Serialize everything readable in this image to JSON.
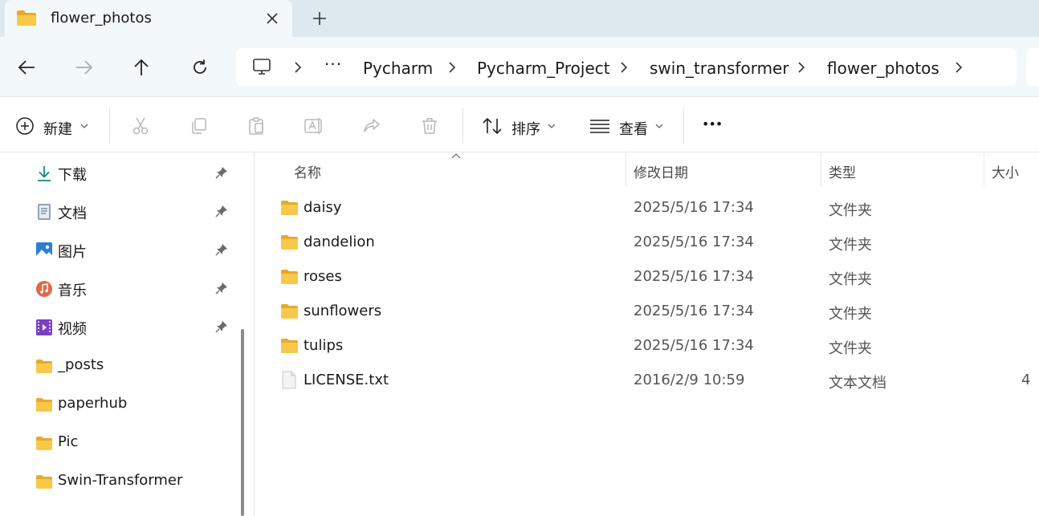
{
  "tab": {
    "title": "flower_photos",
    "close_icon": "close-icon",
    "new_tab_icon": "plus-icon"
  },
  "nav": {
    "back_icon": "arrow-left-icon",
    "forward_icon": "arrow-right-icon",
    "up_icon": "arrow-up-icon",
    "refresh_icon": "refresh-icon"
  },
  "address": {
    "root_icon": "this-pc-icon",
    "overflow": "···",
    "crumbs": [
      "Pycharm",
      "Pycharm_Project",
      "swin_transformer",
      "flower_photos"
    ]
  },
  "commands": {
    "new_label": "新建",
    "sort_label": "排序",
    "view_label": "查看",
    "more_label": "•••"
  },
  "sidebar": {
    "items": [
      {
        "label": "下载",
        "icon": "download-icon",
        "pinned": true
      },
      {
        "label": "文档",
        "icon": "document-icon",
        "pinned": true
      },
      {
        "label": "图片",
        "icon": "pictures-icon",
        "pinned": true
      },
      {
        "label": "音乐",
        "icon": "music-icon",
        "pinned": true
      },
      {
        "label": "视频",
        "icon": "video-icon",
        "pinned": true
      },
      {
        "label": "_posts",
        "icon": "folder-icon",
        "pinned": false
      },
      {
        "label": "paperhub",
        "icon": "folder-icon",
        "pinned": false
      },
      {
        "label": "Pic",
        "icon": "folder-icon",
        "pinned": false
      },
      {
        "label": "Swin-Transformer",
        "icon": "folder-icon",
        "pinned": false
      }
    ]
  },
  "columns": {
    "name": "名称",
    "modified": "修改日期",
    "type": "类型",
    "size": "大小"
  },
  "files": [
    {
      "name": "daisy",
      "modified": "2025/5/16 17:34",
      "type": "文件夹",
      "size": "",
      "icon": "folder-icon"
    },
    {
      "name": "dandelion",
      "modified": "2025/5/16 17:34",
      "type": "文件夹",
      "size": "",
      "icon": "folder-icon"
    },
    {
      "name": "roses",
      "modified": "2025/5/16 17:34",
      "type": "文件夹",
      "size": "",
      "icon": "folder-icon"
    },
    {
      "name": "sunflowers",
      "modified": "2025/5/16 17:34",
      "type": "文件夹",
      "size": "",
      "icon": "folder-icon"
    },
    {
      "name": "tulips",
      "modified": "2025/5/16 17:34",
      "type": "文件夹",
      "size": "",
      "icon": "folder-icon"
    },
    {
      "name": "LICENSE.txt",
      "modified": "2016/2/9 10:59",
      "type": "文本文档",
      "size": "4",
      "icon": "text-file-icon"
    }
  ],
  "colors": {
    "titlebar": "#dde8ef",
    "tab_active": "#f3f8fb",
    "folder_yellow": "#f6c343",
    "accent_teal": "#1a8a7a"
  }
}
